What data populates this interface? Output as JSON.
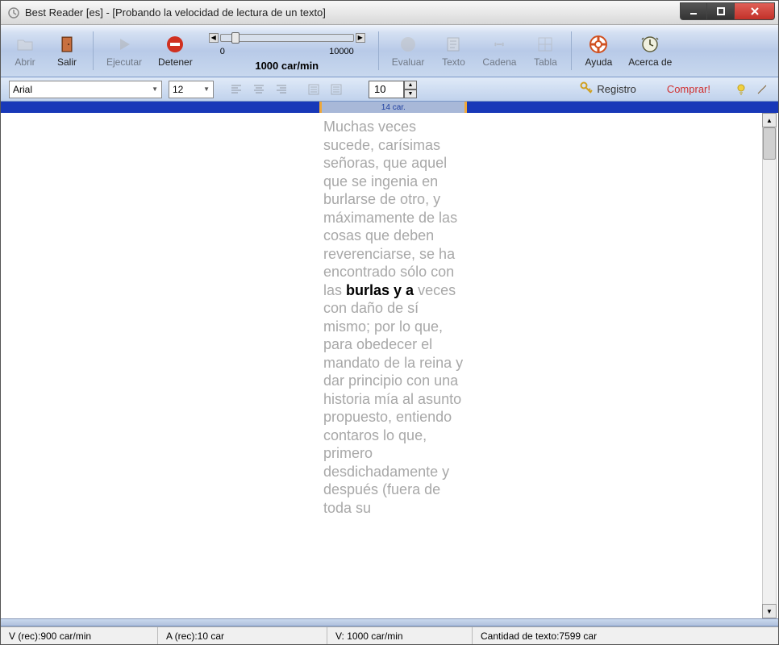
{
  "title": "Best Reader [es] - [Probando la velocidad de lectura de un texto]",
  "toolbar": {
    "abrir": "Abrir",
    "salir": "Salir",
    "ejecutar": "Ejecutar",
    "detener": "Detener",
    "evaluar": "Evaluar",
    "texto": "Texto",
    "cadena": "Cadena",
    "tabla": "Tabla",
    "ayuda": "Ayuda",
    "acerca": "Acerca de"
  },
  "slider": {
    "min": "0",
    "max": "10000",
    "value": "1000 car/min"
  },
  "secondbar": {
    "font": "Arial",
    "size": "12",
    "columns": "10",
    "registro": "Registro",
    "comprar": "Comprar!"
  },
  "ruler": {
    "label": "14 car."
  },
  "text": {
    "before": "Muchas veces sucede, carísimas señoras, que aquel que se ingenia en burlarse de otro, y máximamente de las cosas que deben reverenciarse, se ha encontrado sólo con las ",
    "highlight": "burlas y a",
    "after": " veces con daño de sí mismo; por lo que, para obedecer el mandato de la reina y dar principio con una historia mía al asunto propuesto, entiendo contaros lo que, primero desdichadamente y después (fuera de toda su"
  },
  "status": {
    "vrec": "V (rec):900 car/min",
    "arec": "A (rec):10 car",
    "v": "V: 1000 car/min",
    "cantidad": "Cantidad de texto:7599 car"
  }
}
